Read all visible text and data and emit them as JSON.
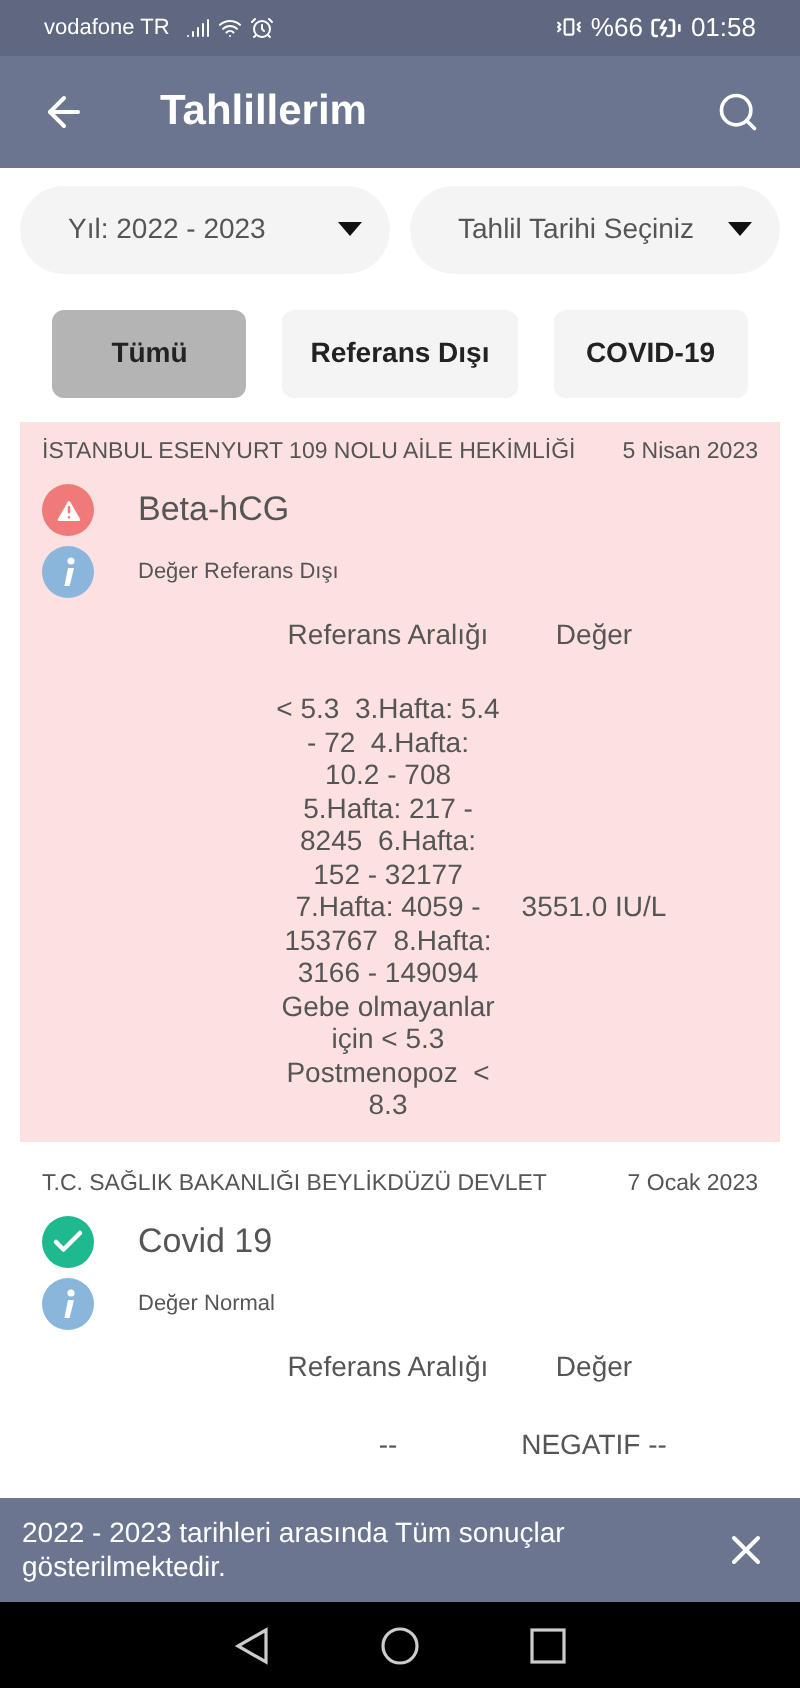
{
  "status_bar": {
    "carrier": "vodafone TR",
    "battery": "%66",
    "time": "01:58"
  },
  "app_bar": {
    "title": "Tahlillerim"
  },
  "dropdowns": [
    {
      "value": "Yıl: 2022 - 2023"
    },
    {
      "value": "Tahlil Tarihi Seçiniz"
    }
  ],
  "filters": [
    {
      "label": "Tümü",
      "selected": true
    },
    {
      "label": "Referans Dışı",
      "selected": false
    },
    {
      "label": "COVID-19",
      "selected": false
    }
  ],
  "results": [
    {
      "kind": "out_of_range",
      "institution": "İSTANBUL ESENYURT 109 NOLU AİLE HEKİMLİĞİ",
      "date": "5 Nisan 2023",
      "test": "Beta-hCG",
      "status": "Değer Referans Dışı",
      "range_header": "Referans Aralığı",
      "value_header": "Değer",
      "range": "< 5.3  3.Hafta: 5.4 - 72  4.Hafta: 10.2 - 708 5.Hafta: 217 - 8245  6.Hafta: 152 - 32177 7.Hafta: 4059 - 153767  8.Hafta: 3166 - 149094 Gebe olmayanlar için < 5.3 Postmenopoz  < 8.3",
      "value": "3551.0 IU/L"
    },
    {
      "kind": "normal",
      "institution": "T.C. SAĞLIK BAKANLIĞI BEYLİKDÜZÜ DEVLET",
      "date": "7 Ocak 2023",
      "test": "Covid 19",
      "status": "Değer Normal",
      "range_header": "Referans Aralığı",
      "value_header": "Değer",
      "range": "--",
      "value": "NEGATIF --"
    }
  ],
  "snackbar": {
    "message": "2022 - 2023 tarihleri arasında Tüm sonuçlar gösterilmektedir."
  }
}
